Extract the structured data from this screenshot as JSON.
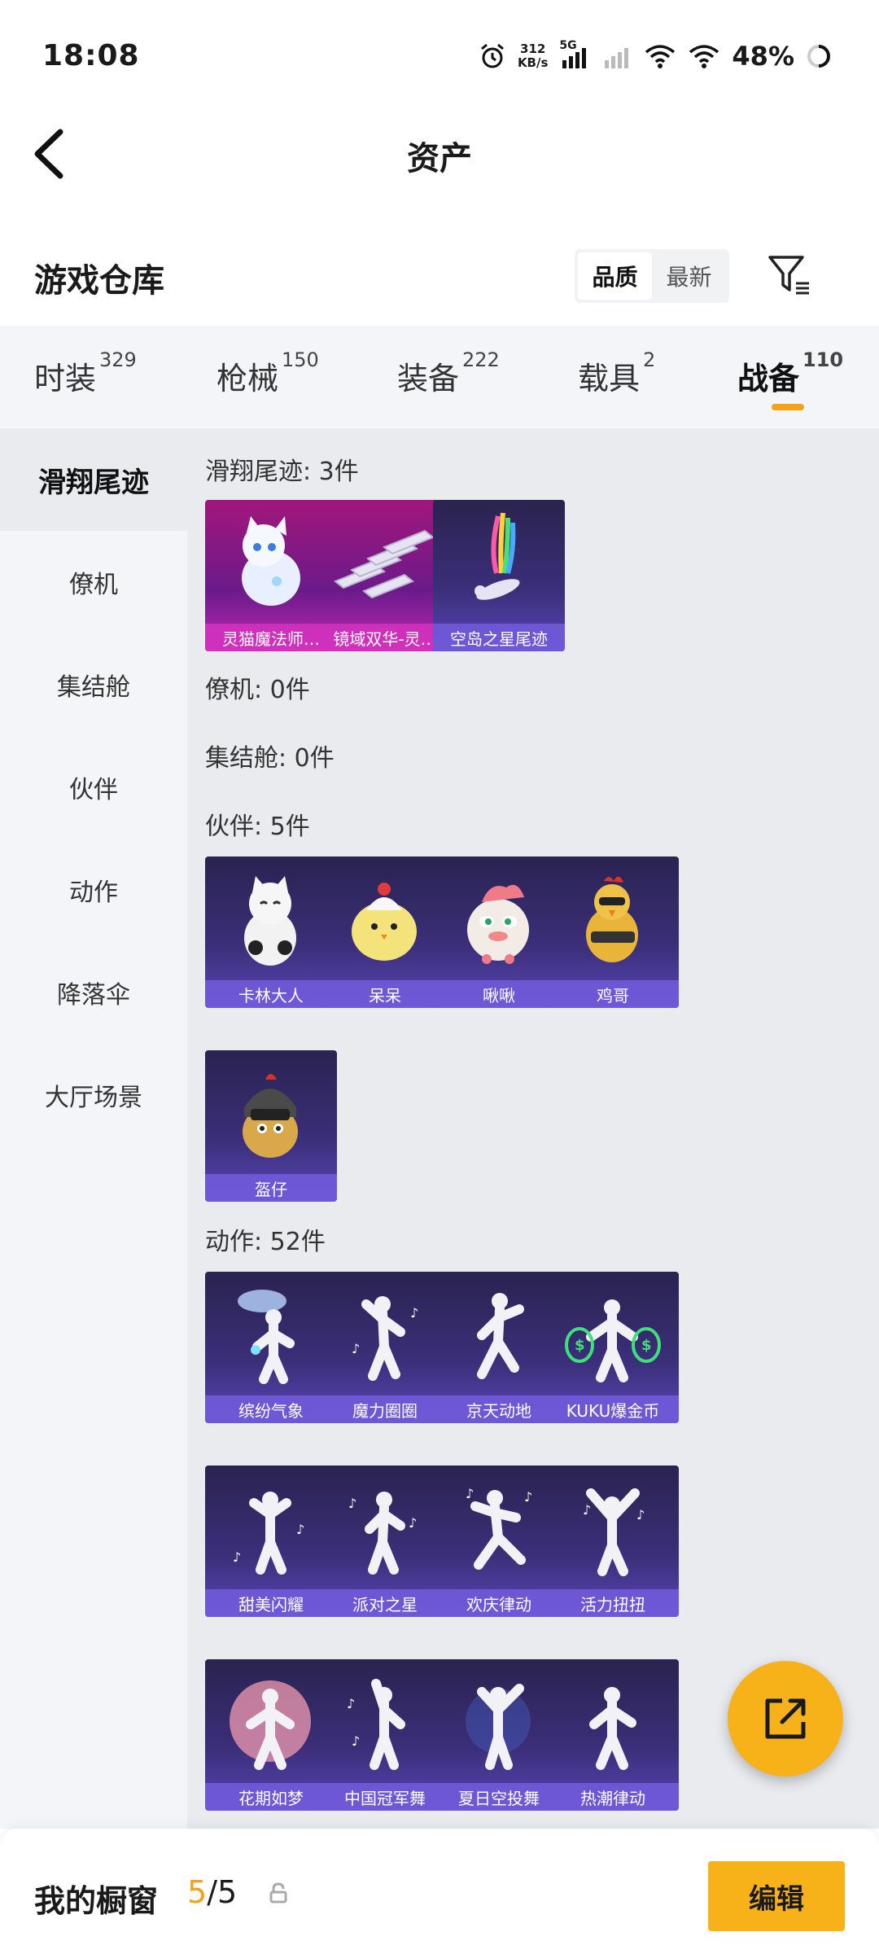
{
  "status_bar": {
    "time": "18:08",
    "net_speed": "312",
    "net_unit": "KB/s",
    "network": "5G",
    "battery": "48%"
  },
  "header": {
    "title": "资产"
  },
  "warehouse": {
    "label": "游戏仓库",
    "sort_quality": "品质",
    "sort_newest": "最新"
  },
  "tabs": [
    {
      "label": "时装",
      "count": "329"
    },
    {
      "label": "枪械",
      "count": "150"
    },
    {
      "label": "装备",
      "count": "222"
    },
    {
      "label": "载具",
      "count": "2"
    },
    {
      "label": "战备",
      "count": "110"
    }
  ],
  "sidebar": [
    "滑翔尾迹",
    "僚机",
    "集结舱",
    "伙伴",
    "动作",
    "降落伞",
    "大厅场景"
  ],
  "sections": {
    "glide": {
      "label": "滑翔尾迹: 3件",
      "items": [
        "灵猫魔法师…",
        "镜域双华-灵…",
        "空岛之星尾迹"
      ]
    },
    "wingman": {
      "label": "僚机: 0件"
    },
    "pod": {
      "label": "集结舱: 0件"
    },
    "partner": {
      "label": "伙伴: 5件",
      "items": [
        "卡林大人",
        "呆呆",
        "啾啾",
        "鸡哥",
        "盔仔"
      ]
    },
    "emote": {
      "label": "动作: 52件",
      "items": [
        "缤纷气象",
        "魔力圈圈",
        "京天动地",
        "KUKU爆金币",
        "甜美闪耀",
        "派对之星",
        "欢庆律动",
        "活力扭扭",
        "花期如梦",
        "中国冠军舞",
        "夏日空投舞",
        "热潮律动"
      ]
    }
  },
  "bottom": {
    "label": "我的橱窗",
    "count_current": "5",
    "count_sep_total": "/5",
    "edit": "编辑"
  },
  "colors": {
    "accent": "#f7b21a",
    "card_purple": "#3b2f7a",
    "card_pink": "#a1177b"
  }
}
